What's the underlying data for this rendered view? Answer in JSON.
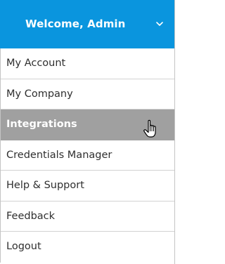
{
  "menu": {
    "header": {
      "title": "Welcome, Admin",
      "icon": "chevron-down-icon"
    },
    "items": [
      {
        "label": "My Account"
      },
      {
        "label": "My Company"
      },
      {
        "label": "Integrations",
        "selected": true
      },
      {
        "label": "Credentials Manager"
      },
      {
        "label": "Help & Support"
      },
      {
        "label": "Feedback"
      },
      {
        "label": "Logout"
      }
    ]
  },
  "colors": {
    "header_bg": "#0a95de",
    "selected_bg": "#a0a0a0",
    "divider": "#d2d2d2"
  },
  "cursor": {
    "icon": "hand-pointer-icon"
  }
}
